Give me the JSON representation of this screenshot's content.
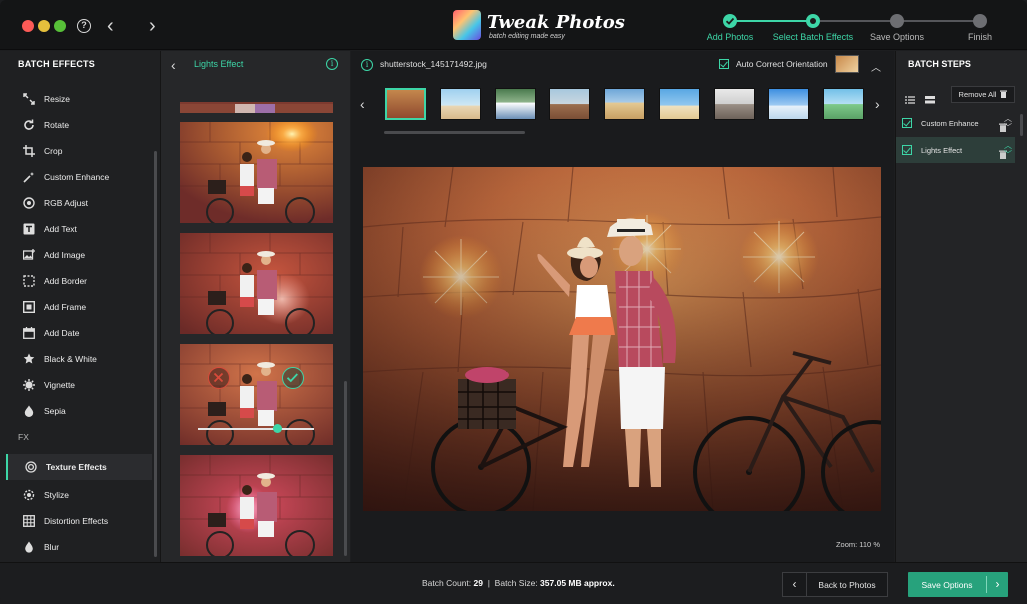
{
  "app": {
    "title": "Tweak Photos",
    "subtitle": "batch editing made easy"
  },
  "stepper": {
    "steps": [
      {
        "label": "Add Photos",
        "state": "done"
      },
      {
        "label": "Select Batch Effects",
        "state": "current"
      },
      {
        "label": "Save Options",
        "state": "pending"
      },
      {
        "label": "Finish",
        "state": "pending"
      }
    ]
  },
  "sidebar": {
    "title": "BATCH EFFECTS",
    "items": [
      {
        "label": "Resize",
        "icon": "resize-icon"
      },
      {
        "label": "Rotate",
        "icon": "rotate-icon"
      },
      {
        "label": "Crop",
        "icon": "crop-icon"
      },
      {
        "label": "Custom Enhance",
        "icon": "enhance-icon"
      },
      {
        "label": "RGB Adjust",
        "icon": "rgb-icon"
      },
      {
        "label": "Add Text",
        "icon": "text-icon"
      },
      {
        "label": "Add Image",
        "icon": "image-icon"
      },
      {
        "label": "Add Border",
        "icon": "border-icon"
      },
      {
        "label": "Add Frame",
        "icon": "frame-icon"
      },
      {
        "label": "Add Date",
        "icon": "calendar-icon"
      },
      {
        "label": "Black & White",
        "icon": "bw-icon"
      },
      {
        "label": "Vignette",
        "icon": "vignette-icon"
      },
      {
        "label": "Sepia",
        "icon": "sepia-icon"
      }
    ],
    "fx_label": "FX",
    "fx_items": [
      {
        "label": "Texture Effects",
        "icon": "texture-icon",
        "active": true
      },
      {
        "label": "Stylize",
        "icon": "stylize-icon"
      },
      {
        "label": "Distortion Effects",
        "icon": "distortion-icon"
      },
      {
        "label": "Blur",
        "icon": "blur-icon"
      }
    ]
  },
  "presets": {
    "title": "Lights Effect",
    "slider_value": 0.68
  },
  "main": {
    "file_name": "shutterstock_145171492.jpg",
    "auto_orient_label": "Auto Correct Orientation",
    "zoom_label": "Zoom: 110 %"
  },
  "right": {
    "title": "BATCH STEPS",
    "remove_all_label": "Remove All",
    "steps": [
      {
        "label": "Custom Enhance"
      },
      {
        "label": "Lights Effect"
      }
    ]
  },
  "bottom": {
    "batch_count_label": "Batch Count:",
    "batch_count": "29",
    "separator": "|",
    "batch_size_label": "Batch Size:",
    "batch_size": "357.05 MB approx.",
    "back_label": "Back to Photos",
    "save_label": "Save Options"
  },
  "colors": {
    "accent": "#3dd6a7",
    "save_button": "#27a27c"
  }
}
